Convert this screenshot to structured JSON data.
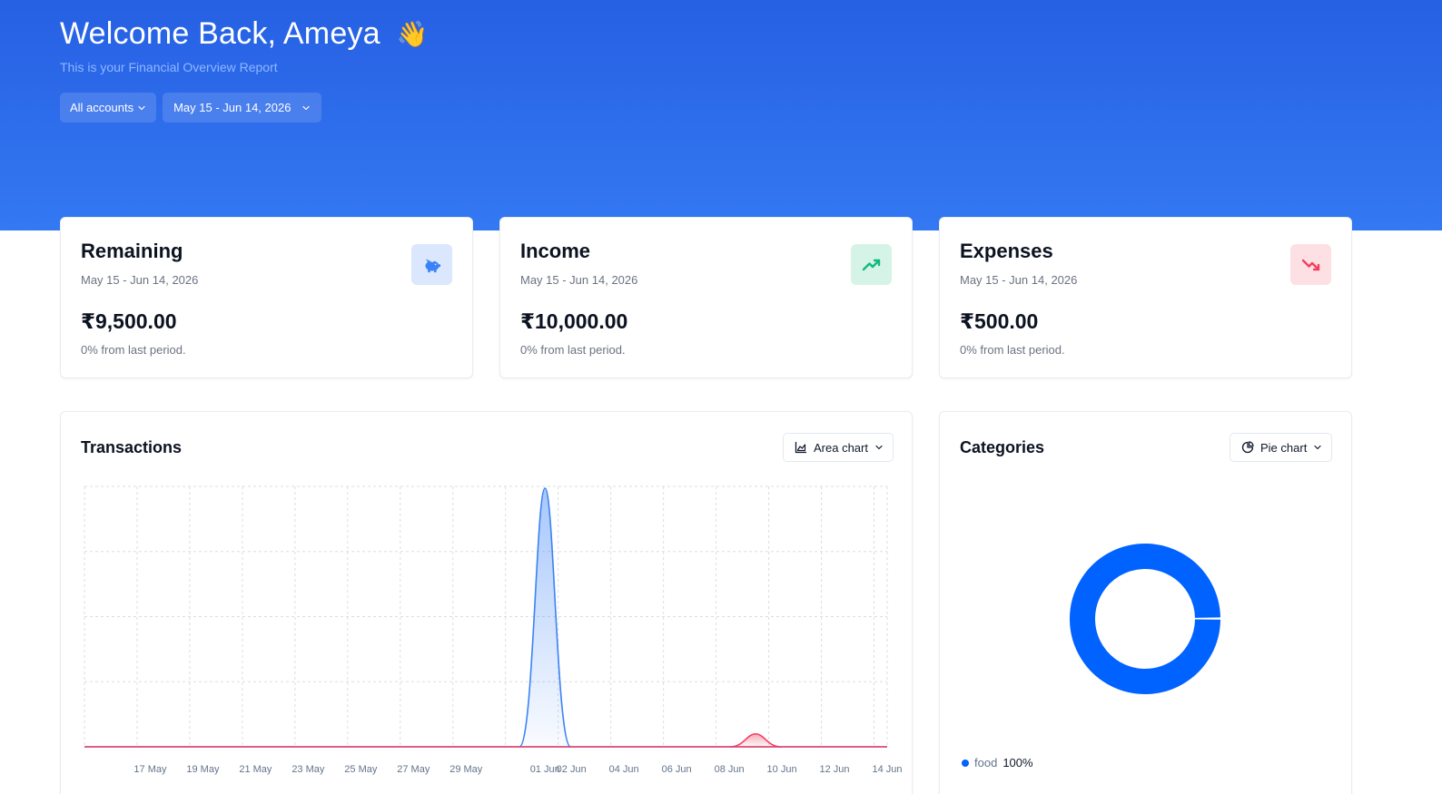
{
  "header": {
    "greeting": "Welcome Back, Ameya",
    "wave": "👋",
    "subtitle": "This is your Financial Overview Report",
    "account_filter": "All accounts",
    "date_filter": "May 15 - Jun 14, 2026"
  },
  "cards": {
    "remaining": {
      "title": "Remaining",
      "range": "May 15 - Jun 14, 2026",
      "amount": "₹9,500.00",
      "change": "0% from last period.",
      "icon": "piggy-bank-icon",
      "color": "#3b82f6"
    },
    "income": {
      "title": "Income",
      "range": "May 15 - Jun 14, 2026",
      "amount": "₹10,000.00",
      "change": "0% from last period.",
      "icon": "trending-up-icon",
      "color": "#10b981"
    },
    "expenses": {
      "title": "Expenses",
      "range": "May 15 - Jun 14, 2026",
      "amount": "₹500.00",
      "change": "0% from last period.",
      "icon": "trending-down-icon",
      "color": "#f43f5e"
    }
  },
  "transactions": {
    "title": "Transactions",
    "chart_type_label": "Area chart"
  },
  "categories": {
    "title": "Categories",
    "chart_type_label": "Pie chart",
    "legend": [
      {
        "name": "food",
        "percent": "100%",
        "color": "#0062ff"
      }
    ]
  },
  "chart_data": [
    {
      "type": "area",
      "x_ticks": [
        "17 May",
        "19 May",
        "21 May",
        "23 May",
        "25 May",
        "27 May",
        "29 May",
        "01 Jun",
        "02 Jun",
        "04 Jun",
        "06 Jun",
        "08 Jun",
        "10 Jun",
        "12 Jun",
        "14 Jun"
      ],
      "series": [
        {
          "color": "#3b82f6",
          "points": [
            {
              "x": "01 Jun",
              "y": 10000
            }
          ]
        },
        {
          "color": "#f43f5e",
          "points": [
            {
              "x": "09 Jun",
              "y": 500
            }
          ]
        }
      ],
      "grid": true
    },
    {
      "type": "pie",
      "labels": [
        "food"
      ],
      "values": [
        100
      ],
      "colors": [
        "#0062ff"
      ],
      "donut": true
    }
  ]
}
